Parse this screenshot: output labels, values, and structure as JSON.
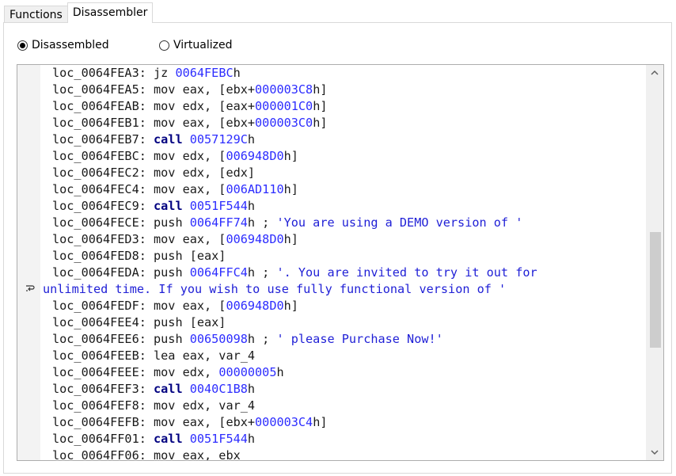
{
  "tabs": [
    {
      "label": "Functions",
      "active": false
    },
    {
      "label": "Disassembler",
      "active": true
    }
  ],
  "view_mode": {
    "options": [
      {
        "label": "Disassembled",
        "checked": true
      },
      {
        "label": "Virtualized",
        "checked": false
      }
    ]
  },
  "lines": [
    [
      {
        "t": "addr",
        "v": "loc_0064FEA3: "
      },
      {
        "t": "txt",
        "v": "jz "
      },
      {
        "t": "num",
        "v": "0064FEBC"
      },
      {
        "t": "txt",
        "v": "h"
      }
    ],
    [
      {
        "t": "addr",
        "v": "loc_0064FEA5: "
      },
      {
        "t": "txt",
        "v": "mov eax, [ebx+"
      },
      {
        "t": "num",
        "v": "000003C8"
      },
      {
        "t": "txt",
        "v": "h]"
      }
    ],
    [
      {
        "t": "addr",
        "v": "loc_0064FEAB: "
      },
      {
        "t": "txt",
        "v": "mov edx, [eax+"
      },
      {
        "t": "num",
        "v": "000001C0"
      },
      {
        "t": "txt",
        "v": "h]"
      }
    ],
    [
      {
        "t": "addr",
        "v": "loc_0064FEB1: "
      },
      {
        "t": "txt",
        "v": "mov eax, [ebx+"
      },
      {
        "t": "num",
        "v": "000003C0"
      },
      {
        "t": "txt",
        "v": "h]"
      }
    ],
    [
      {
        "t": "addr",
        "v": "loc_0064FEB7: "
      },
      {
        "t": "kw",
        "v": "call"
      },
      {
        "t": "txt",
        "v": " "
      },
      {
        "t": "num",
        "v": "0057129C"
      },
      {
        "t": "txt",
        "v": "h"
      }
    ],
    [
      {
        "t": "addr",
        "v": "loc_0064FEBC: "
      },
      {
        "t": "txt",
        "v": "mov edx, ["
      },
      {
        "t": "num",
        "v": "006948D0"
      },
      {
        "t": "txt",
        "v": "h]"
      }
    ],
    [
      {
        "t": "addr",
        "v": "loc_0064FEC2: "
      },
      {
        "t": "txt",
        "v": "mov edx, [edx]"
      }
    ],
    [
      {
        "t": "addr",
        "v": "loc_0064FEC4: "
      },
      {
        "t": "txt",
        "v": "mov eax, ["
      },
      {
        "t": "num",
        "v": "006AD110"
      },
      {
        "t": "txt",
        "v": "h]"
      }
    ],
    [
      {
        "t": "addr",
        "v": "loc_0064FEC9: "
      },
      {
        "t": "kw",
        "v": "call"
      },
      {
        "t": "txt",
        "v": " "
      },
      {
        "t": "num",
        "v": "0051F544"
      },
      {
        "t": "txt",
        "v": "h"
      }
    ],
    [
      {
        "t": "addr",
        "v": "loc_0064FECE: "
      },
      {
        "t": "txt",
        "v": "push "
      },
      {
        "t": "num",
        "v": "0064FF74"
      },
      {
        "t": "txt",
        "v": "h ; "
      },
      {
        "t": "cmt",
        "v": "'You are using a DEMO version of '"
      }
    ],
    [
      {
        "t": "addr",
        "v": "loc_0064FED3: "
      },
      {
        "t": "txt",
        "v": "mov eax, ["
      },
      {
        "t": "num",
        "v": "006948D0"
      },
      {
        "t": "txt",
        "v": "h]"
      }
    ],
    [
      {
        "t": "addr",
        "v": "loc_0064FED8: "
      },
      {
        "t": "txt",
        "v": "push [eax]"
      }
    ],
    [
      {
        "t": "addr",
        "v": "loc_0064FEDA: "
      },
      {
        "t": "txt",
        "v": "push "
      },
      {
        "t": "num",
        "v": "0064FFC4"
      },
      {
        "t": "txt",
        "v": "h ; "
      },
      {
        "t": "cmt",
        "v": "'. You are invited to try it out for"
      }
    ],
    [
      {
        "t": "cmt",
        "v": "unlimited time. If you wish to use fully functional version of '",
        "wrap": true
      }
    ],
    [
      {
        "t": "addr",
        "v": "loc_0064FEDF: "
      },
      {
        "t": "txt",
        "v": "mov eax, ["
      },
      {
        "t": "num",
        "v": "006948D0"
      },
      {
        "t": "txt",
        "v": "h]"
      }
    ],
    [
      {
        "t": "addr",
        "v": "loc_0064FEE4: "
      },
      {
        "t": "txt",
        "v": "push [eax]"
      }
    ],
    [
      {
        "t": "addr",
        "v": "loc_0064FEE6: "
      },
      {
        "t": "txt",
        "v": "push "
      },
      {
        "t": "num",
        "v": "00650098"
      },
      {
        "t": "txt",
        "v": "h ; "
      },
      {
        "t": "cmt",
        "v": "' please Purchase Now!'"
      }
    ],
    [
      {
        "t": "addr",
        "v": "loc_0064FEEB: "
      },
      {
        "t": "txt",
        "v": "lea eax, var_4"
      }
    ],
    [
      {
        "t": "addr",
        "v": "loc_0064FEEE: "
      },
      {
        "t": "txt",
        "v": "mov edx, "
      },
      {
        "t": "num",
        "v": "00000005"
      },
      {
        "t": "txt",
        "v": "h"
      }
    ],
    [
      {
        "t": "addr",
        "v": "loc_0064FEF3: "
      },
      {
        "t": "kw",
        "v": "call"
      },
      {
        "t": "txt",
        "v": " "
      },
      {
        "t": "num",
        "v": "0040C1B8"
      },
      {
        "t": "txt",
        "v": "h"
      }
    ],
    [
      {
        "t": "addr",
        "v": "loc_0064FEF8: "
      },
      {
        "t": "txt",
        "v": "mov edx, var_4"
      }
    ],
    [
      {
        "t": "addr",
        "v": "loc_0064FEFB: "
      },
      {
        "t": "txt",
        "v": "mov eax, [ebx+"
      },
      {
        "t": "num",
        "v": "000003C4"
      },
      {
        "t": "txt",
        "v": "h]"
      }
    ],
    [
      {
        "t": "addr",
        "v": "loc_0064FF01: "
      },
      {
        "t": "kw",
        "v": "call"
      },
      {
        "t": "txt",
        "v": " "
      },
      {
        "t": "num",
        "v": "0051F544"
      },
      {
        "t": "txt",
        "v": "h"
      }
    ],
    [
      {
        "t": "addr",
        "v": "loc_0064FF06: "
      },
      {
        "t": "txt",
        "v": "mov eax, ebx"
      }
    ]
  ],
  "icons": {
    "wrap": "word-wrap-icon",
    "scroll_up": "chevron-up-icon",
    "scroll_down": "chevron-down-icon"
  }
}
